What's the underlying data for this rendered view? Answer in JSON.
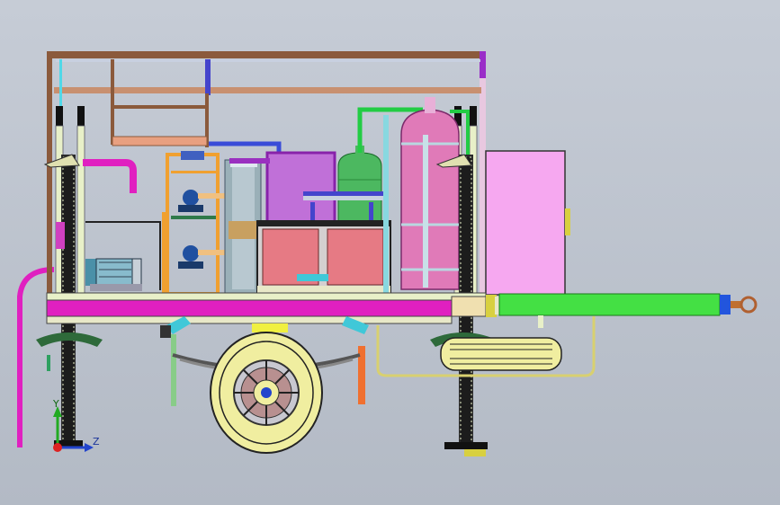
{
  "viewport": {
    "background": "#bfc5cf",
    "triad": {
      "y_label": "Y",
      "z_label": "Z",
      "y_color": "#22aa22",
      "z_color": "#2244cc",
      "x_color": "#dd2222"
    }
  },
  "colors": {
    "frame_brown": "#8b5a3c",
    "magenta": "#e020c0",
    "cyan": "#40c8d8",
    "green": "#22cc44",
    "pink_tank": "#e07ab8",
    "battery": "#e07a80",
    "yellow_tire": "#f0eea0",
    "panel_pink": "#f6a8f0"
  }
}
